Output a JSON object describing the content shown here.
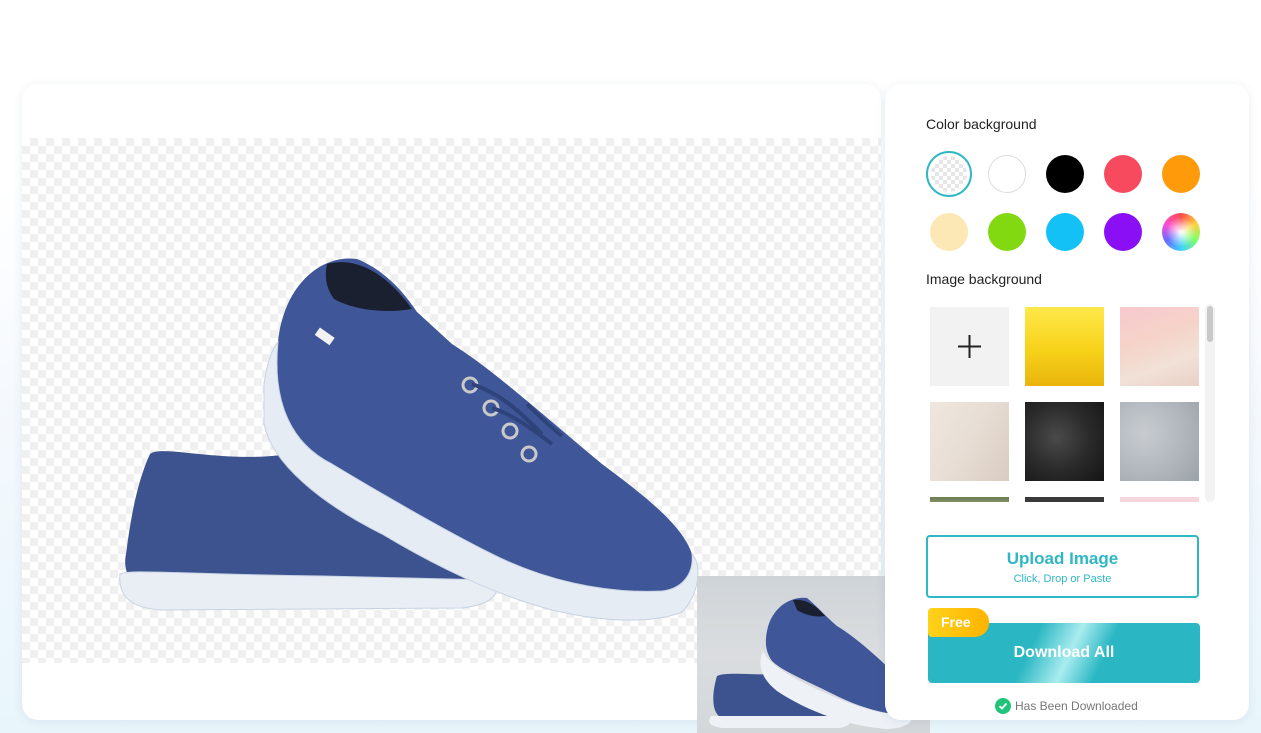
{
  "panel": {
    "color_background_label": "Color background",
    "image_background_label": "Image background",
    "swatches": [
      {
        "name": "transparent",
        "color": "transparent"
      },
      {
        "name": "white",
        "color": "#ffffff"
      },
      {
        "name": "black",
        "color": "#000000"
      },
      {
        "name": "red",
        "color": "#f84a5f"
      },
      {
        "name": "orange",
        "color": "#ff9a0a"
      },
      {
        "name": "cream",
        "color": "#fbe8b5"
      },
      {
        "name": "green",
        "color": "#82d912"
      },
      {
        "name": "sky-blue",
        "color": "#13c1f7"
      },
      {
        "name": "purple",
        "color": "#8b0ff5"
      },
      {
        "name": "rainbow",
        "color": "multicolor"
      }
    ],
    "thumbnails": [
      "add",
      "yellow",
      "pink-watercolor",
      "beige",
      "black-marble",
      "grey-glitter",
      "plant",
      "dark",
      "pink"
    ],
    "upload": {
      "title": "Upload Image",
      "subtitle": "Click, Drop or Paste"
    },
    "download": {
      "label": "Download All",
      "badge": "Free"
    },
    "status": "Has Been Downloaded"
  },
  "colors": {
    "accent": "#2fb8c4",
    "success": "#21c37a",
    "badge": "#ffc20e"
  }
}
